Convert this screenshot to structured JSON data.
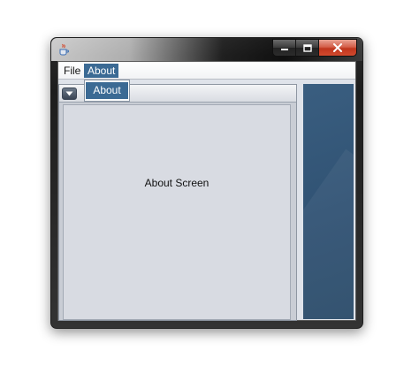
{
  "window": {
    "icon": "java-cup-icon",
    "controls": [
      "minimize-icon",
      "maximize-icon",
      "close-icon"
    ]
  },
  "menubar": {
    "items": [
      {
        "label": "File"
      },
      {
        "label": "About"
      }
    ]
  },
  "dropdown": {
    "items": [
      {
        "label": "About"
      }
    ]
  },
  "internal_frame": {
    "menu_icon": "chevron-down-icon",
    "content_label": "About Screen"
  },
  "colors": {
    "selection": "#3b6a94",
    "desktop_panel": "#305273"
  }
}
